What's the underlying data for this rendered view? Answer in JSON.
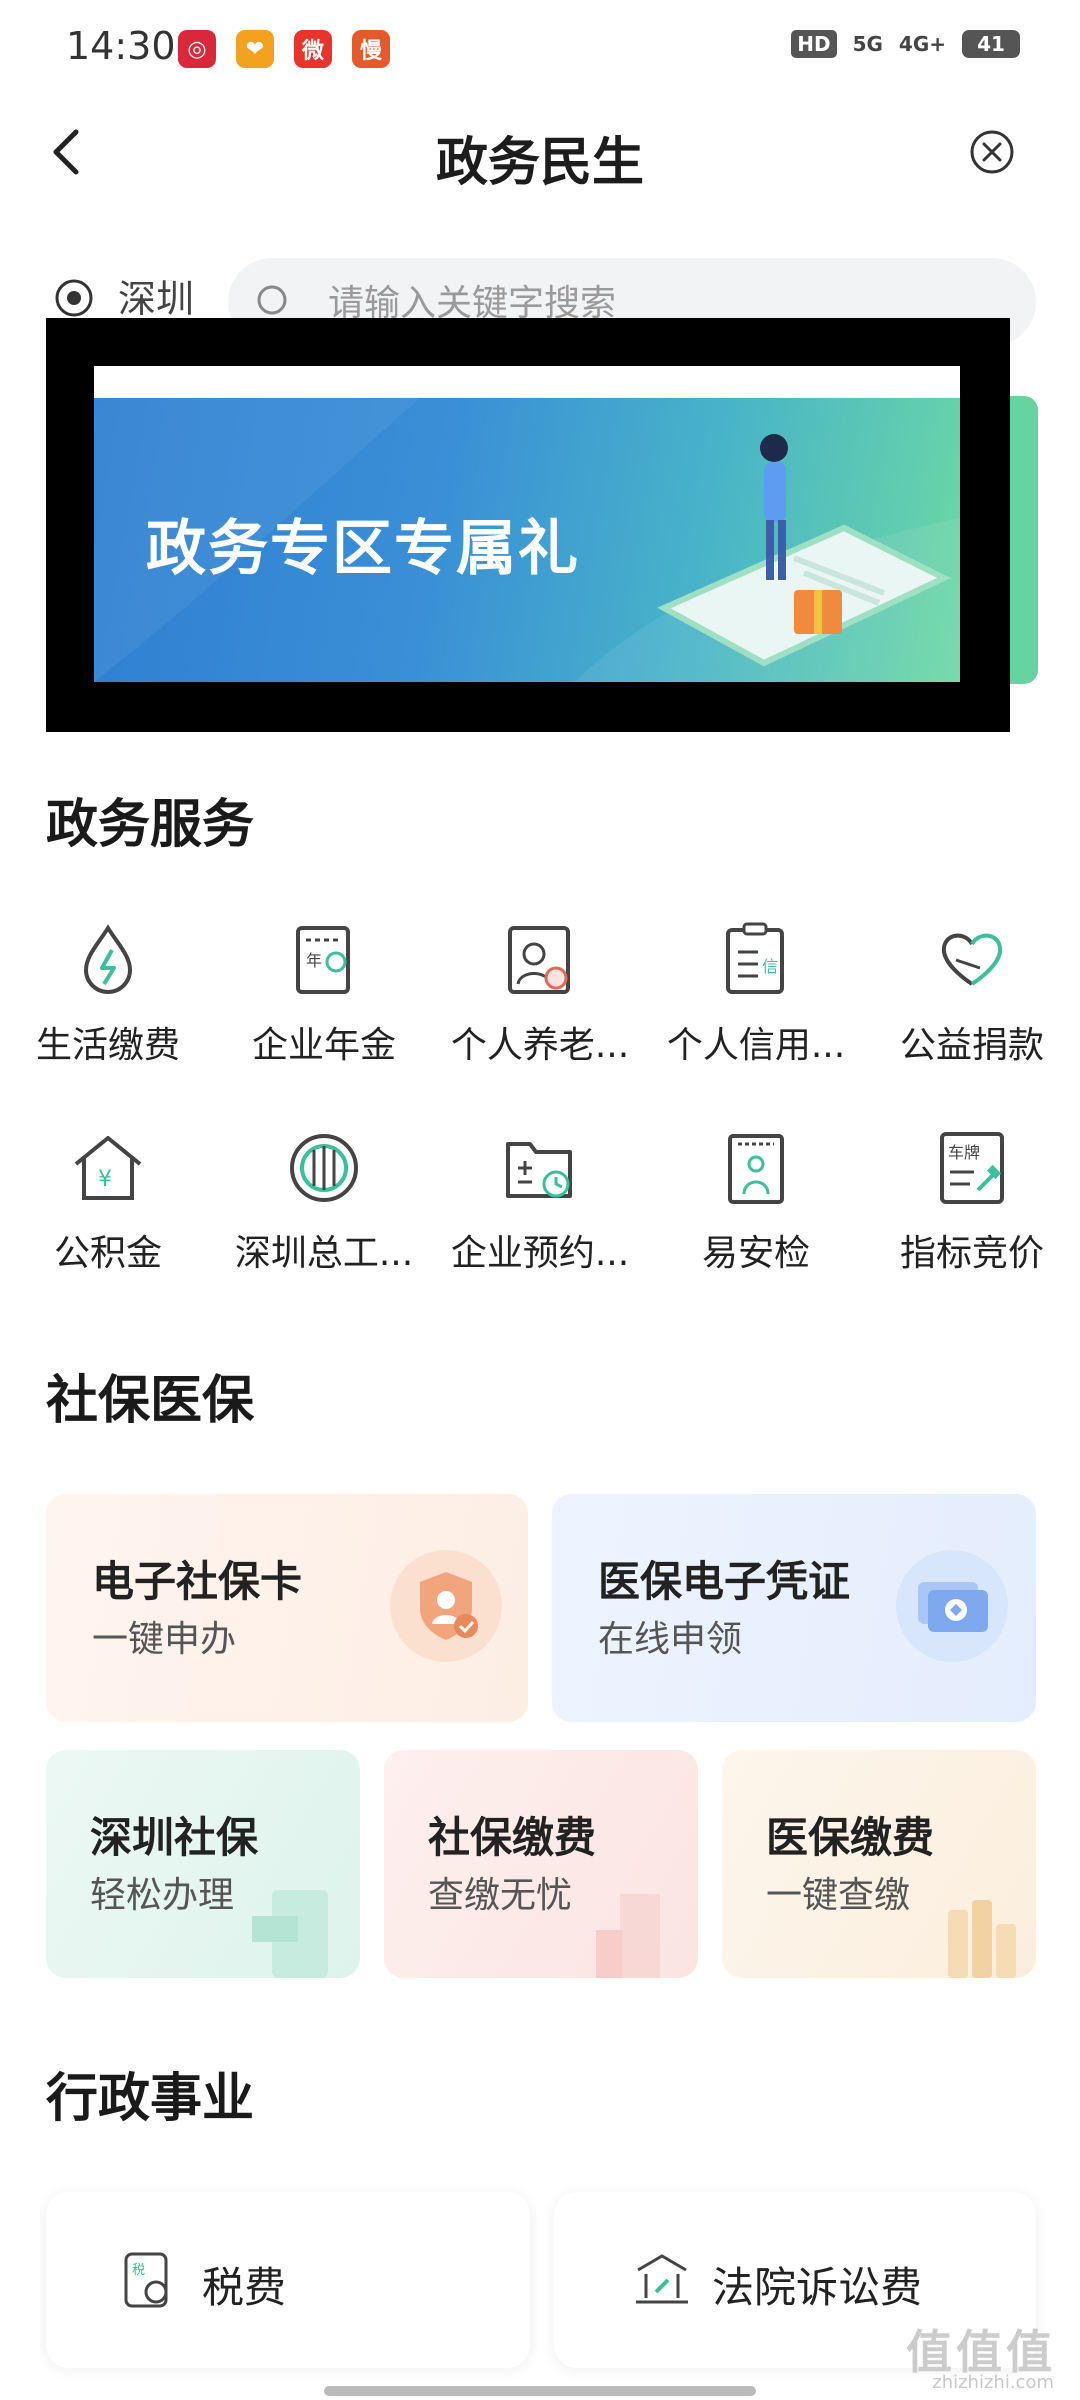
{
  "status_bar": {
    "time": "14:30",
    "apps": [
      {
        "icon": "netease-music-icon",
        "glyph": "◎",
        "color": "#d8283a"
      },
      {
        "icon": "heart-app-icon",
        "glyph": "❤",
        "color": "#f2a21e"
      },
      {
        "icon": "weibo-icon",
        "glyph": "微",
        "color": "#e8352c"
      },
      {
        "icon": "manbo-icon",
        "glyph": "慢",
        "color": "#e55a2c"
      }
    ],
    "hd": "HD",
    "signal_1": "5G",
    "signal_2": "4G+",
    "battery": "41"
  },
  "header": {
    "title": "政务民生"
  },
  "search": {
    "city": "深圳",
    "placeholder": "请输入关键字搜索"
  },
  "banner": {
    "text": "政务专区专属礼"
  },
  "gov_services": {
    "title": "政务服务",
    "items": [
      {
        "label": "生活缴费",
        "icon": "water-bolt-icon"
      },
      {
        "label": "企业年金",
        "icon": "annuity-doc-icon"
      },
      {
        "label": "个人养老...",
        "icon": "pension-icon"
      },
      {
        "label": "个人信用...",
        "icon": "credit-report-icon"
      },
      {
        "label": "公益捐款",
        "icon": "charity-hands-icon"
      },
      {
        "label": "公积金",
        "icon": "housing-fund-icon"
      },
      {
        "label": "深圳总工...",
        "icon": "union-badge-icon"
      },
      {
        "label": "企业预约...",
        "icon": "folder-clock-icon"
      },
      {
        "label": "易安检",
        "icon": "security-gate-icon"
      },
      {
        "label": "指标竞价",
        "icon": "license-plate-icon"
      }
    ]
  },
  "social_insurance": {
    "title": "社保医保",
    "big_cards": [
      {
        "title": "电子社保卡",
        "sub": "一键申办"
      },
      {
        "title": "医保电子凭证",
        "sub": "在线申领"
      }
    ],
    "small_cards": [
      {
        "title": "深圳社保",
        "sub": "轻松办理"
      },
      {
        "title": "社保缴费",
        "sub": "查缴无忧"
      },
      {
        "title": "医保缴费",
        "sub": "一键查缴"
      }
    ]
  },
  "admin": {
    "title": "行政事业",
    "tiles": [
      {
        "label": "税费"
      },
      {
        "label": "法院诉讼费"
      }
    ]
  },
  "watermark": {
    "main": "值值值",
    "sub": "zhizhizhi.com"
  }
}
